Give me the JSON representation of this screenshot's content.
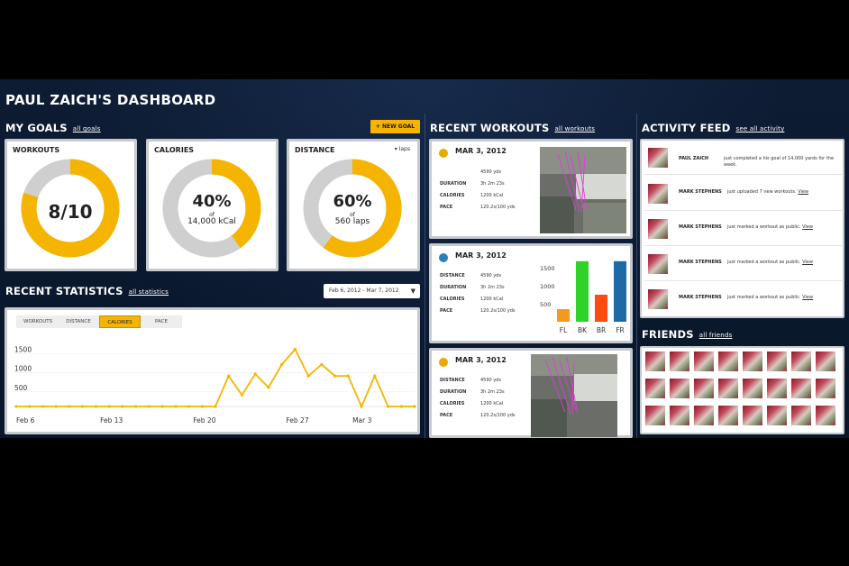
{
  "dashboard_title": "PAUL ZAICH'S DASHBOARD",
  "colors": {
    "accent": "#f5b400",
    "ring_bg": "#cfcfcf",
    "bar_fl": "#f29a1b",
    "bar_bk": "#2fd12a",
    "bar_br": "#ff4a12",
    "bar_fr": "#1c6aa8"
  },
  "goals": {
    "title": "MY GOALS",
    "link": "all goals",
    "new_goal": "+ NEW GOAL",
    "workouts": {
      "label": "WORKOUTS",
      "value": "8/10",
      "progress": 0.8
    },
    "calories": {
      "label": "CALORIES",
      "percent": "40%",
      "of": "of",
      "target": "14,000 kCal",
      "progress": 0.4
    },
    "distance": {
      "label": "DISTANCE",
      "option": "▾ laps",
      "percent": "60%",
      "of": "of",
      "target": "560 laps",
      "progress": 0.6
    }
  },
  "statistics": {
    "title": "RECENT STATISTICS",
    "link": "all statistics",
    "date_range": "Feb 6, 2012 - Mar 7, 2012",
    "tabs": [
      "WORKOUTS",
      "DISTANCE",
      "CALORIES",
      "PACE"
    ],
    "active_tab": "CALORIES"
  },
  "chart_data": [
    {
      "type": "line",
      "y_ticks": [
        "1500",
        "1000",
        "500"
      ],
      "x_tick_labels": [
        "Feb 6",
        "Feb 13",
        "Feb 20",
        "Feb 27",
        "Mar 3"
      ],
      "ylim": [
        0,
        1700
      ],
      "x": [
        "Feb 6",
        "Feb 7",
        "Feb 8",
        "Feb 9",
        "Feb 10",
        "Feb 11",
        "Feb 12",
        "Feb 13",
        "Feb 14",
        "Feb 15",
        "Feb 16",
        "Feb 17",
        "Feb 18",
        "Feb 19",
        "Feb 20",
        "Feb 21",
        "Feb 22",
        "Feb 23",
        "Feb 24",
        "Feb 25",
        "Feb 26",
        "Feb 27",
        "Feb 28",
        "Feb 29",
        "Mar 1",
        "Mar 2",
        "Mar 3",
        "Mar 4",
        "Mar 5",
        "Mar 6",
        "Mar 7"
      ],
      "values": [
        0,
        0,
        0,
        0,
        0,
        0,
        0,
        0,
        0,
        0,
        0,
        0,
        0,
        0,
        0,
        0,
        800,
        300,
        850,
        500,
        1100,
        1500,
        800,
        1100,
        800,
        800,
        0,
        800,
        0,
        0,
        0
      ]
    },
    {
      "type": "bar",
      "categories": [
        "FL",
        "BK",
        "BR",
        "FR"
      ],
      "values": [
        350,
        1680,
        750,
        1680
      ],
      "y_ticks": [
        "1500",
        "1000",
        "500"
      ],
      "ylim": [
        0,
        1700
      ]
    }
  ],
  "workouts": {
    "title": "RECENT WORKOUTS",
    "link": "all workouts",
    "items": [
      {
        "date": "MAR 3, 2012",
        "distance_label": "",
        "distance": "4590 yds",
        "duration_label": "DURATION",
        "duration": "3h 2m 23s",
        "calories_label": "CALORIES",
        "calories": "1200 kCal",
        "pace_label": "PACE",
        "pace": "120.2s/100 yds"
      },
      {
        "date": "MAR 3, 2012",
        "distance_label": "DISTANCE",
        "distance": "4590 yds",
        "duration_label": "DURATION",
        "duration": "3h 2m 23s",
        "calories_label": "CALORIES",
        "calories": "1200 kCal",
        "pace_label": "PACE",
        "pace": "120.2s/100 yds"
      },
      {
        "date": "MAR 3, 2012",
        "distance_label": "DISTANCE",
        "distance": "4590 yds",
        "duration_label": "DURATION",
        "duration": "3h 2m 23s",
        "calories_label": "CALORIES",
        "calories": "1200 kCal",
        "pace_label": "PACE",
        "pace": "120.2s/100 yds"
      }
    ]
  },
  "feed": {
    "title": "ACTIVITY FEED",
    "link": "see all activity",
    "items": [
      {
        "name": "PAUL ZAICH",
        "text": "just completed a his goal of 14,000 yards for the",
        "text2": "week.",
        "link": ""
      },
      {
        "name": "MARK STEPHENS",
        "text": "just uploaded 7 new workouts.",
        "link": "View"
      },
      {
        "name": "MARK STEPHENS",
        "text": "just marked a workout as public.",
        "link": "View"
      },
      {
        "name": "MARK STEPHENS",
        "text": "just marked a workout as public.",
        "link": "View"
      },
      {
        "name": "MARK STEPHENS",
        "text": "just marked a workout as public.",
        "link": "View"
      }
    ]
  },
  "friends": {
    "title": "FRIENDS",
    "link": "all friends",
    "count": 24
  }
}
